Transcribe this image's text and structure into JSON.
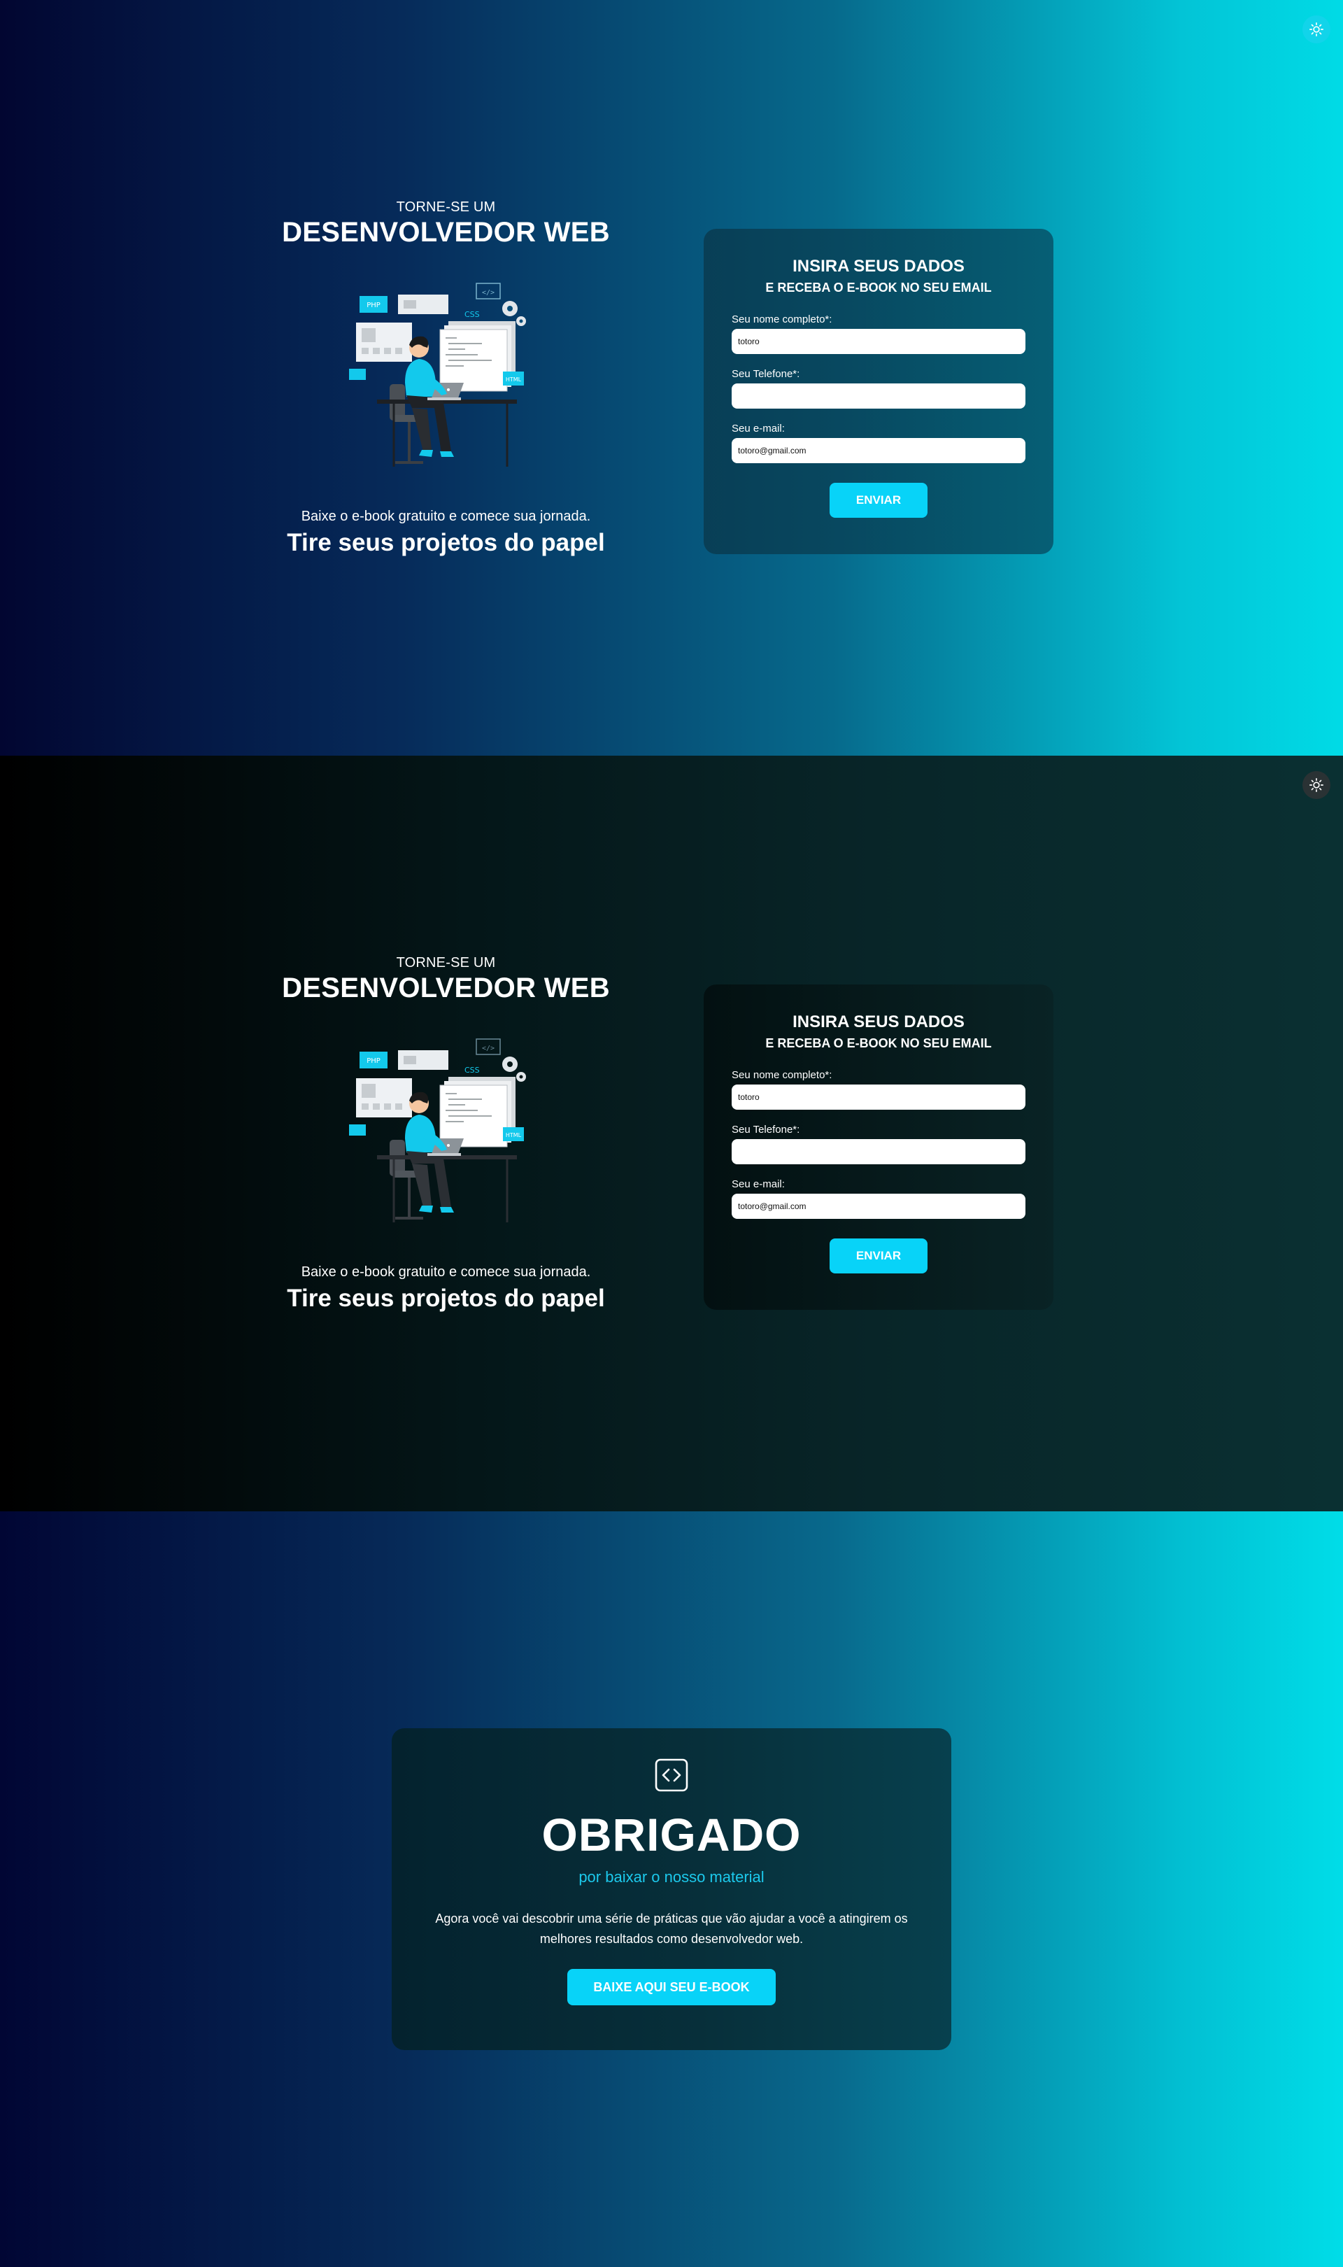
{
  "hero": {
    "kicker": "TORNE-SE UM",
    "headline": "DESENVOLVEDOR WEB",
    "subtitle": "Baixe o e-book gratuito e comece sua jornada.",
    "tagline": "Tire seus projetos do papel",
    "illustration_labels": {
      "php": "PHP",
      "css": "CSS",
      "code": "</>",
      "html": "HTML"
    }
  },
  "form": {
    "title": "INSIRA SEUS DADOS",
    "subtitle": "E RECEBA O E-BOOK NO SEU EMAIL",
    "fields": [
      {
        "label": "Seu nome completo*:",
        "value": "totoro"
      },
      {
        "label": "Seu Telefone*:",
        "value": ""
      },
      {
        "label": "Seu e-mail:",
        "value": "totoro@gmail.com"
      }
    ],
    "submit_label": "ENVIAR"
  },
  "thanks": {
    "title": "OBRIGADO",
    "subtitle": "por baixar o nosso material",
    "text": "Agora você vai descobrir uma série de práticas que vão ajudar a você a atingirem os melhores resultados como desenvolvedor web.",
    "button_label": "BAIXE AQUI SEU E-BOOK"
  },
  "theme_toggle_icon": "sun-icon",
  "colors": {
    "accent": "#08d3f8",
    "accent_text": "#1cc9ec",
    "light_bg_start": "#020631",
    "light_bg_end": "#00dbe6",
    "dark_bg_start": "#000000",
    "dark_bg_end": "#0a3032"
  }
}
